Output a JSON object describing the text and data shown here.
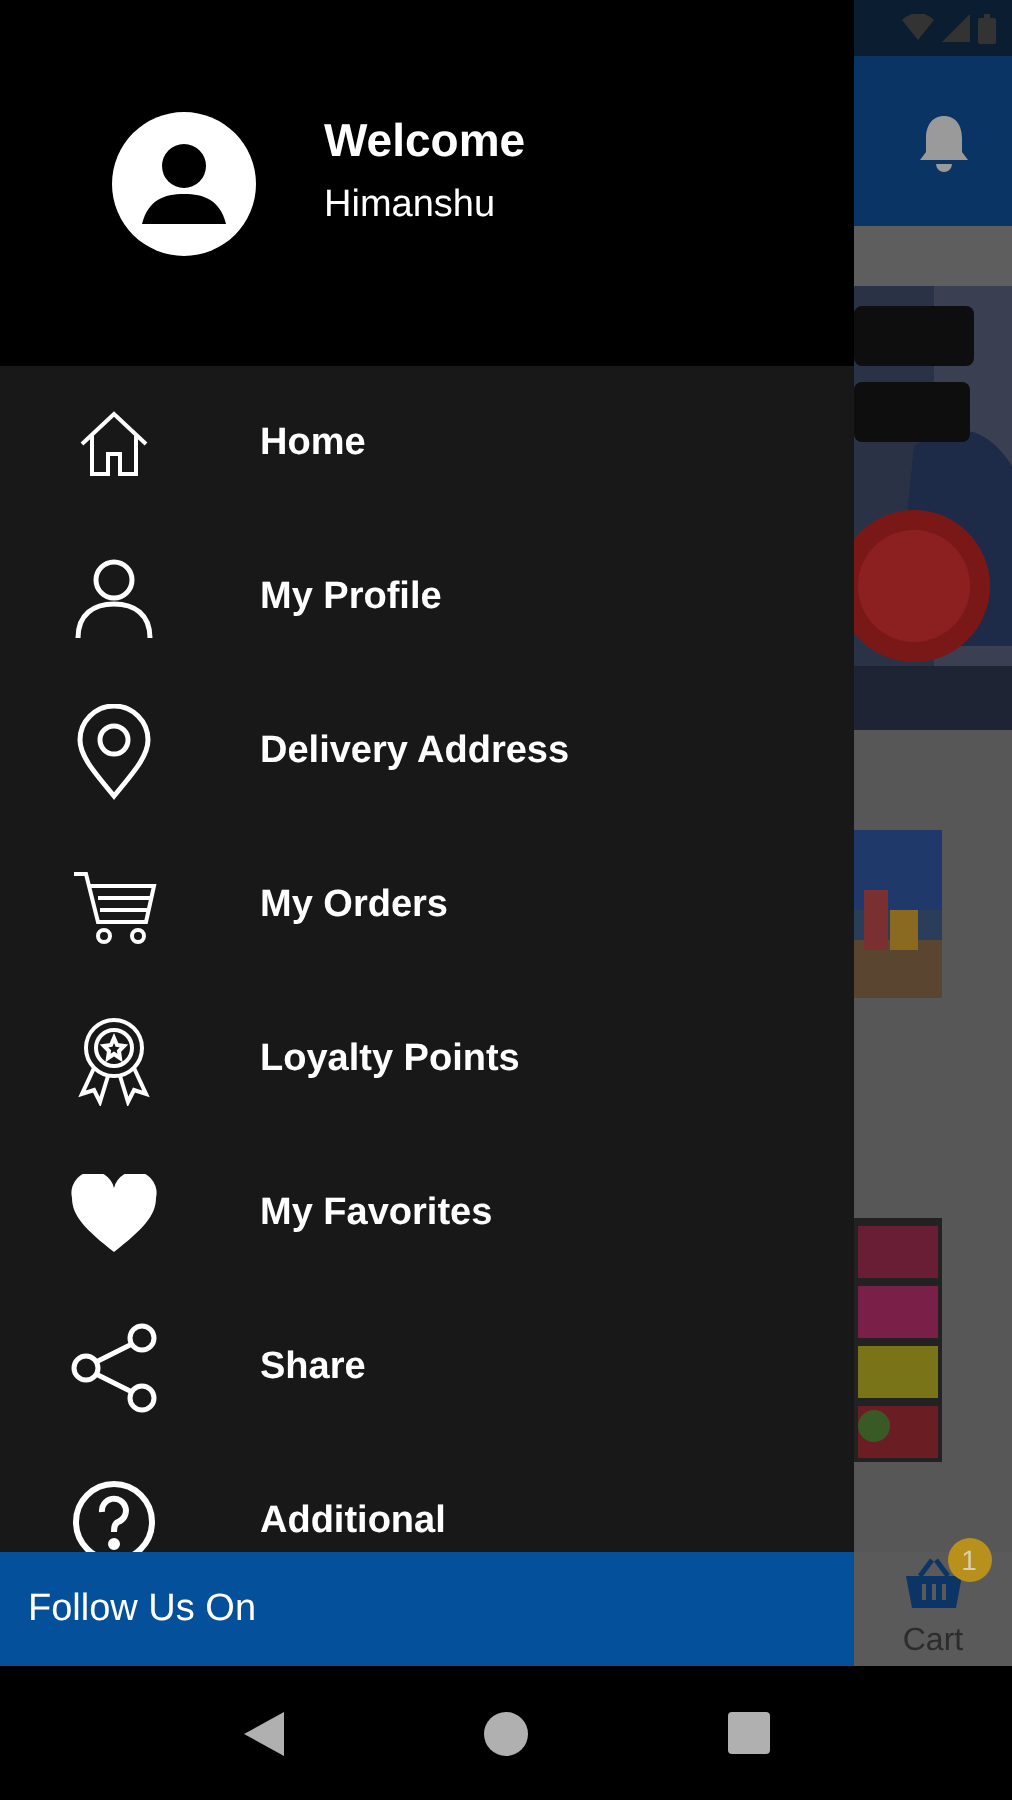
{
  "drawer": {
    "header": {
      "title": "Welcome",
      "user_name": "Himanshu"
    },
    "menu": [
      {
        "label": "Home"
      },
      {
        "label": "My Profile"
      },
      {
        "label": "Delivery Address"
      },
      {
        "label": "My Orders"
      },
      {
        "label": "Loyalty Points"
      },
      {
        "label": "My Favorites"
      },
      {
        "label": "Share"
      },
      {
        "label": "Additional"
      }
    ],
    "footer": {
      "label": "Follow Us On"
    }
  },
  "background_app": {
    "bottom_nav": {
      "cart_label": "Cart",
      "cart_badge": "1"
    }
  }
}
